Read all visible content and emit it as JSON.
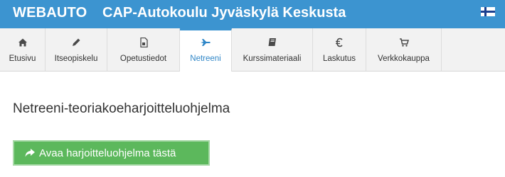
{
  "header": {
    "app_name": "WEBAUTO",
    "school_name": "CAP-Autokoulu Jyväskylä Keskusta",
    "language_flag_icon": "finland-flag-icon"
  },
  "tabs": [
    {
      "label": "Etusivu",
      "icon": "home-icon",
      "active": false
    },
    {
      "label": "Itseopiskelu",
      "icon": "pencil-icon",
      "active": false
    },
    {
      "label": "Opetustiedot",
      "icon": "document-icon",
      "active": false
    },
    {
      "label": "Netreeni",
      "icon": "airplane-icon",
      "active": true
    },
    {
      "label": "Kurssimateriaali",
      "icon": "book-icon",
      "active": false
    },
    {
      "label": "Laskutus",
      "icon": "euro-icon",
      "active": false
    },
    {
      "label": "Verkkokauppa",
      "icon": "cart-icon",
      "active": false
    }
  ],
  "main": {
    "title": "Netreeni-teoriakoeharjoitteluohjelma",
    "cta_label": "Avaa harjoitteluohjelma tästä",
    "cta_icon": "share-arrow-icon"
  },
  "colors": {
    "header_bg": "#3c94d0",
    "active_tab_text": "#2f86c7",
    "button_green": "#5cb85c"
  }
}
